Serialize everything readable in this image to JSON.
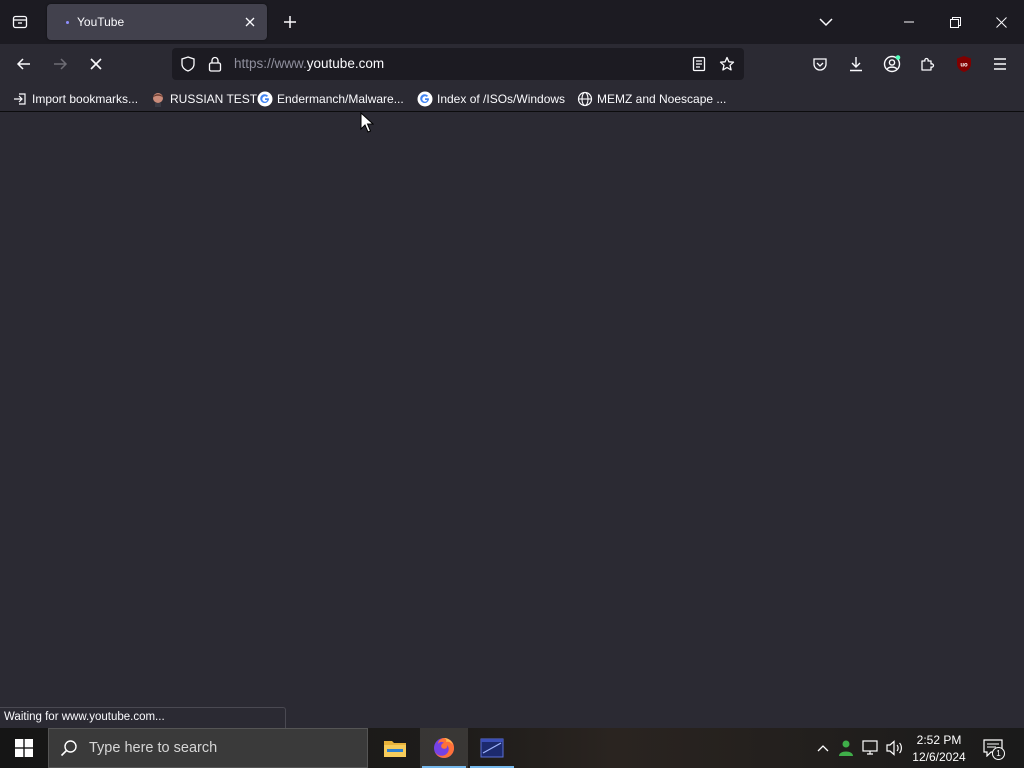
{
  "tab_bar": {
    "tabs": [
      {
        "title": "YouTube",
        "loading": true
      }
    ]
  },
  "nav": {
    "url_prefix": "https://www.",
    "url_host": "youtube.com"
  },
  "bookmarks": [
    {
      "label": "Import bookmarks...",
      "icon": "import-icon"
    },
    {
      "label": "RUSSIAN TEST",
      "icon": "person-icon"
    },
    {
      "label": "Endermanch/Malware...",
      "icon": "google-icon"
    },
    {
      "label": "Index of /ISOs/Windows",
      "icon": "google-icon"
    },
    {
      "label": "MEMZ and Noescape ...",
      "icon": "globe-icon"
    }
  ],
  "status": {
    "text": "Waiting for www.youtube.com..."
  },
  "taskbar": {
    "search_placeholder": "Type here to search",
    "time": "2:52 PM",
    "date": "12/6/2024",
    "notification_count": "1"
  },
  "colors": {
    "chrome_dark": "#1c1b22",
    "chrome": "#2b2a33",
    "tab_active": "#42414d",
    "text": "#fbfbfe",
    "ublock_red": "#800000",
    "accent_blue": "#76b9ed"
  }
}
